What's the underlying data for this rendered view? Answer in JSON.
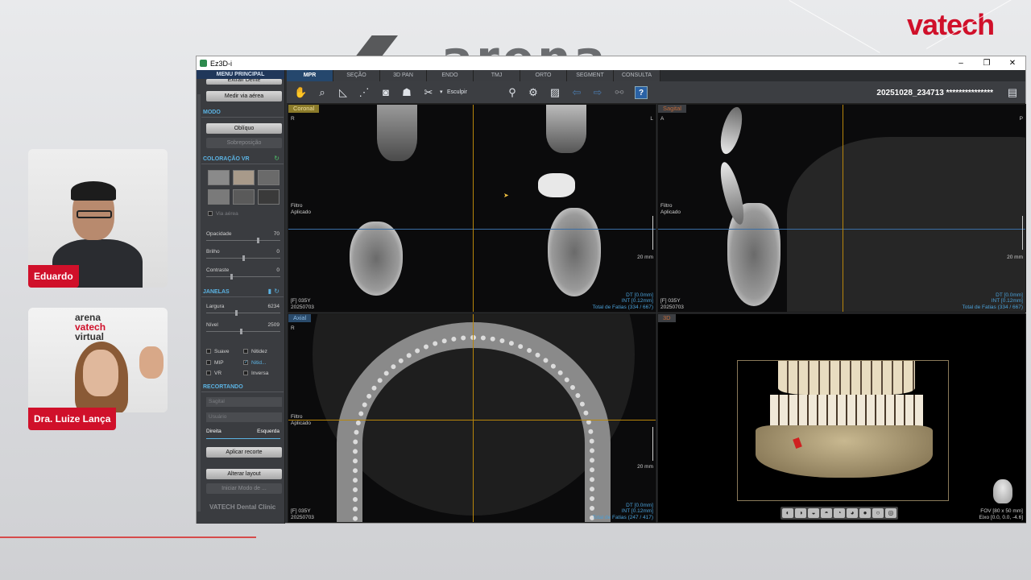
{
  "background": {
    "arena_text": "arena",
    "brand_logo": "vatech",
    "brand_color": "#d0102a"
  },
  "participants": [
    {
      "name": "Eduardo"
    },
    {
      "name": "Dra. Luize Lança",
      "logo_line1": "arena",
      "logo_line2": "vatech",
      "logo_line3": "virtual"
    }
  ],
  "window": {
    "title": "Ez3D-i",
    "controls": [
      "–",
      "❐",
      "✕"
    ]
  },
  "sidebar": {
    "header": "MENU PRINCIPAL",
    "cut_button": "Extrair Dente",
    "airway_button": "Medir via aérea",
    "mode_title": "MODO",
    "oblique_button": "Oblíquo",
    "overlay_button": "Sobreposição",
    "vr_title": "COLORAÇÃO VR",
    "airway_check": "Via aérea",
    "opacity_label": "Opacidade",
    "opacity_value": "70",
    "brightness_label": "Brilho",
    "brightness_value": "0",
    "contrast_label": "Contraste",
    "contrast_value": "0",
    "windows_title": "JANELAS",
    "width_label": "Largura",
    "width_value": "6234",
    "level_label": "Nível",
    "level_value": "2509",
    "checks": [
      "Suave",
      "Nitidez",
      "MIP",
      "Nitid...",
      "VR",
      "Inversa"
    ],
    "crop_title": "RECORTANDO",
    "crop_select1": "Sagital",
    "crop_select2": "Usuário",
    "dir_left": "Direita",
    "dir_right": "Esquerda",
    "apply_crop": "Aplicar recorte",
    "change_layout": "Alterar layout",
    "start_mode": "Iniciar Modo de ...",
    "clinic": "VATECH Dental Clinic"
  },
  "tabs": [
    "MPR",
    "SEÇÃO",
    "3D PAN",
    "ENDO",
    "TMJ",
    "ORTO",
    "SEGMENT",
    "CONSULTA"
  ],
  "toolbar": {
    "sculpt_label": "Esculpir",
    "patient_id": "20251028_234713 ***************"
  },
  "views": {
    "coronal": {
      "label": "Coronal",
      "label_color": "#8a7a2a",
      "left_marker": "R",
      "right_marker": "L",
      "filter": [
        "Filtro",
        "Aplicado"
      ],
      "scale": "20 mm",
      "info_left": [
        "[F] 035Y",
        "20250703"
      ],
      "info_right": [
        "DT [0.0mm]",
        "INT [0.12mm]",
        "Total de Fatias (334 / 667)"
      ]
    },
    "sagittal": {
      "label": "Sagital",
      "label_color": "#8a4a2a",
      "left_marker": "A",
      "right_marker": "P",
      "filter": [
        "Filtro",
        "Aplicado"
      ],
      "scale": "20 mm",
      "info_left": [
        "[F] 035Y",
        "20250703"
      ],
      "info_right": [
        "DT [0.0mm]",
        "INT [0.12mm]",
        "Total de Fatias (334 / 667)"
      ]
    },
    "axial": {
      "label": "Axial",
      "label_color": "#2a4a6a",
      "left_marker": "R",
      "filter": [
        "Filtro",
        "Aplicado"
      ],
      "scale": "20 mm",
      "info_left": [
        "[F] 035Y",
        "20250703"
      ],
      "info_right": [
        "DT [0.0mm]",
        "INT [0.12mm]",
        "Total de Fatias (247 / 417)"
      ]
    },
    "render3d": {
      "label": "3D",
      "info_right": [
        "FOV [80 x 50 mm]",
        "Eixo [0.0, 0.0, -4.6]"
      ]
    }
  }
}
